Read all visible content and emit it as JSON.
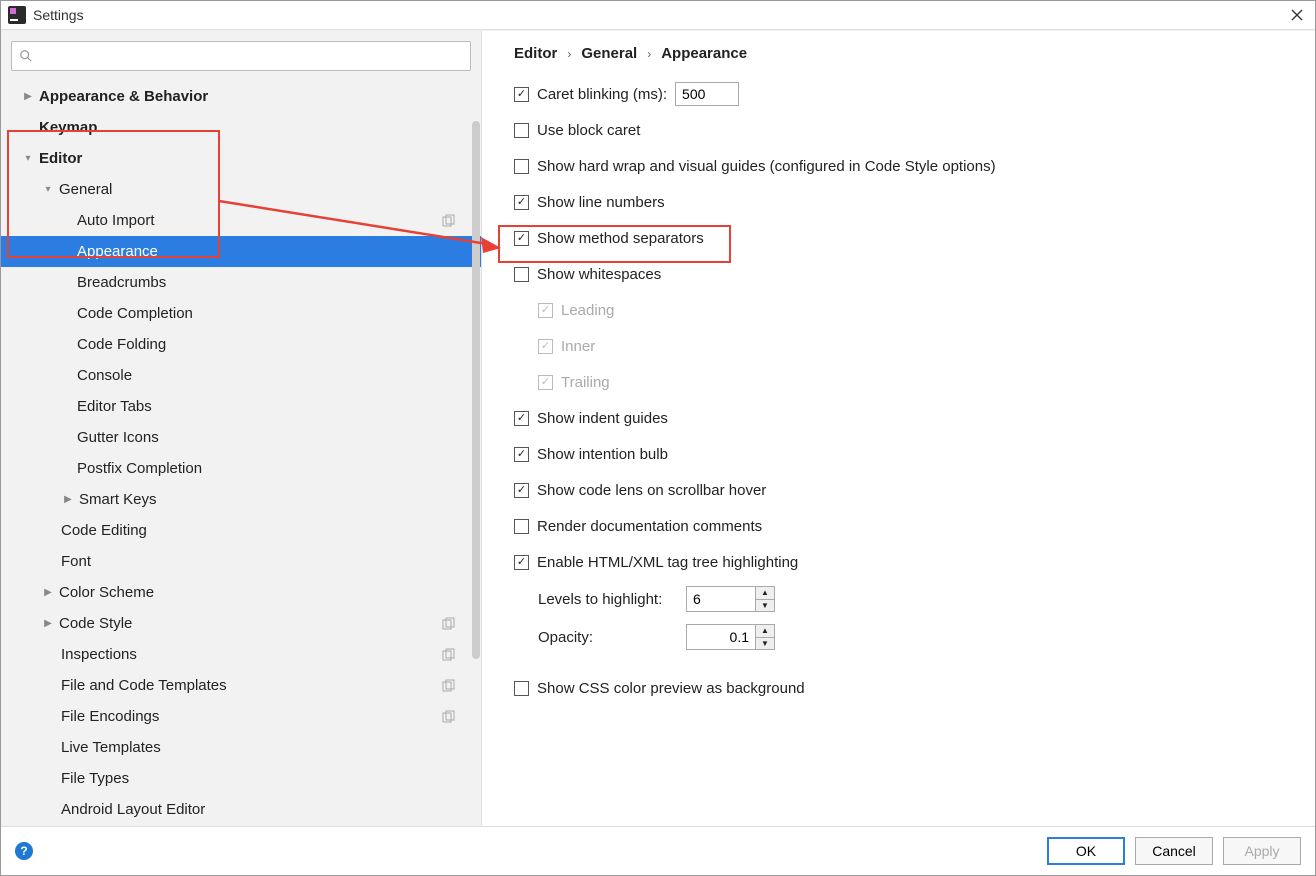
{
  "window": {
    "title": "Settings"
  },
  "search": {
    "placeholder": ""
  },
  "tree": {
    "appearance_behavior": "Appearance & Behavior",
    "keymap": "Keymap",
    "editor": "Editor",
    "general": "General",
    "auto_import": "Auto Import",
    "appearance": "Appearance",
    "breadcrumbs": "Breadcrumbs",
    "code_completion": "Code Completion",
    "code_folding": "Code Folding",
    "console": "Console",
    "editor_tabs": "Editor Tabs",
    "gutter_icons": "Gutter Icons",
    "postfix_completion": "Postfix Completion",
    "smart_keys": "Smart Keys",
    "code_editing": "Code Editing",
    "font": "Font",
    "color_scheme": "Color Scheme",
    "code_style": "Code Style",
    "inspections": "Inspections",
    "file_code_templates": "File and Code Templates",
    "file_encodings": "File Encodings",
    "live_templates": "Live Templates",
    "file_types": "File Types",
    "android_layout_editor": "Android Layout Editor"
  },
  "breadcrumb": {
    "a": "Editor",
    "b": "General",
    "c": "Appearance"
  },
  "opts": {
    "caret_blinking_label": "Caret blinking (ms):",
    "caret_blinking_value": "500",
    "use_block_caret": "Use block caret",
    "show_hard_wrap": "Show hard wrap and visual guides (configured in Code Style options)",
    "show_line_numbers": "Show line numbers",
    "show_method_separators": "Show method separators",
    "show_whitespaces": "Show whitespaces",
    "leading": "Leading",
    "inner": "Inner",
    "trailing": "Trailing",
    "show_indent_guides": "Show indent guides",
    "show_intention_bulb": "Show intention bulb",
    "show_code_lens": "Show code lens on scrollbar hover",
    "render_doc": "Render documentation comments",
    "enable_html_xml": "Enable HTML/XML tag tree highlighting",
    "levels_to_highlight_label": "Levels to highlight:",
    "levels_to_highlight_value": "6",
    "opacity_label": "Opacity:",
    "opacity_value": "0.1",
    "show_css_color": "Show CSS color preview as background"
  },
  "footer": {
    "ok": "OK",
    "cancel": "Cancel",
    "apply": "Apply"
  }
}
